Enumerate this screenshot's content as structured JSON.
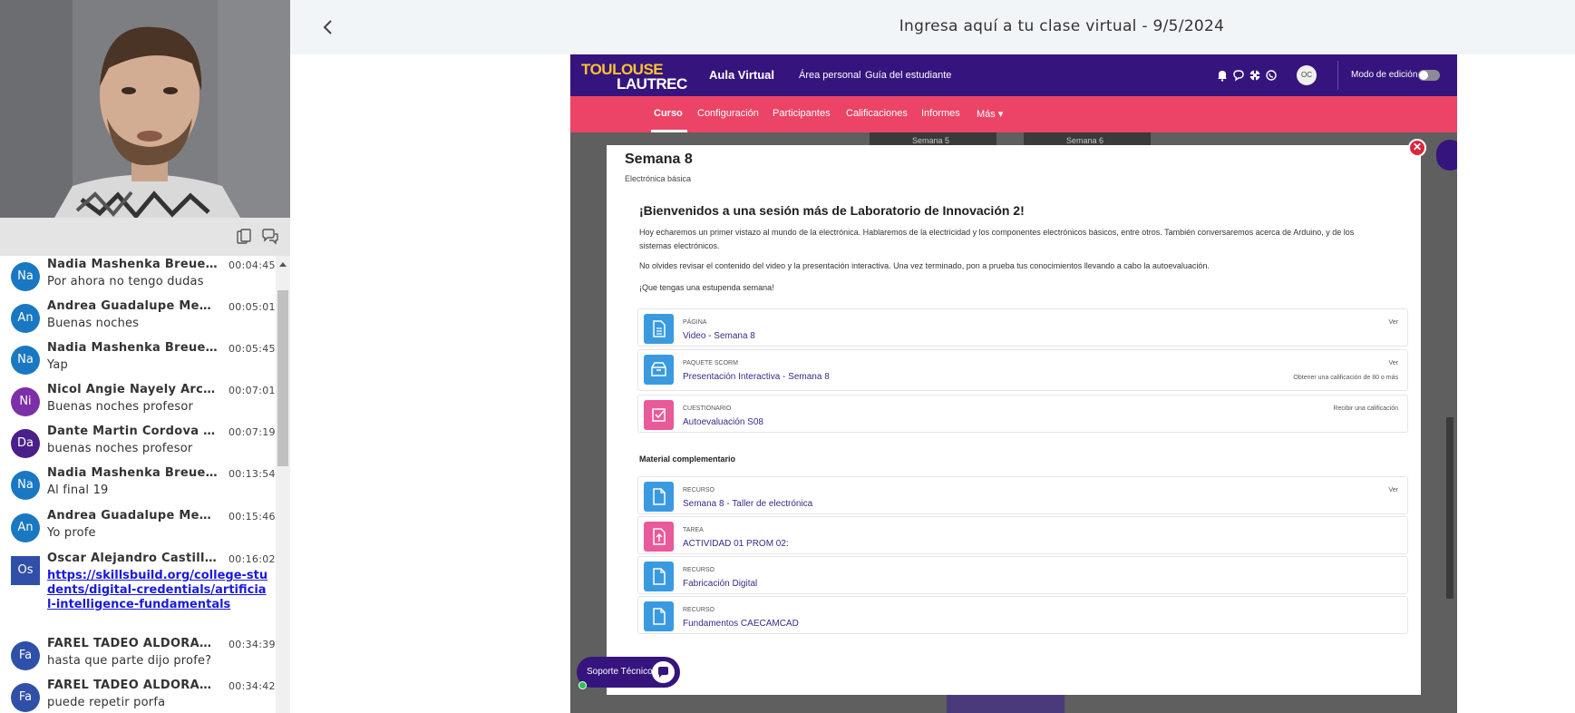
{
  "header": {
    "title": "Ingresa aquí a tu clase virtual - 9/5/2024",
    "back_icon": "chevron-left-icon"
  },
  "chat": {
    "messages": [
      {
        "initials": "Na",
        "color": "#1a78c2",
        "name": "Nadia Mashenka Breuer ...",
        "time": "00:04:45",
        "text": "Por ahora no tengo dudas"
      },
      {
        "initials": "An",
        "color": "#1a78c2",
        "name": "Andrea Guadalupe Mena...",
        "time": "00:05:01",
        "text": "Buenas noches"
      },
      {
        "initials": "Na",
        "color": "#1a78c2",
        "name": "Nadia Mashenka Breuer ...",
        "time": "00:05:45",
        "text": "Yap"
      },
      {
        "initials": "Ni",
        "color": "#7b2fa8",
        "name": "Nicol Angie Nayely Arca...",
        "time": "00:07:01",
        "text": "Buenas noches profesor"
      },
      {
        "initials": "Da",
        "color": "#4a1f8a",
        "name": "Dante Martin Cordova M...",
        "time": "00:07:19",
        "text": "buenas noches profesor"
      },
      {
        "initials": "Na",
        "color": "#1a78c2",
        "name": "Nadia Mashenka Breuer ...",
        "time": "00:13:54",
        "text": "Al final  19"
      },
      {
        "initials": "An",
        "color": "#1a78c2",
        "name": "Andrea Guadalupe Mena...",
        "time": "00:15:46",
        "text": "Yo profe"
      },
      {
        "initials": "Os",
        "color": "#2f4fa8",
        "name": "Oscar Alejandro Castillo...",
        "time": "00:16:02",
        "link": "https://skillsbuild.org/college-students/digital-credentials/artificial-intelligence-fundamentals"
      },
      {
        "initials": "Fa",
        "color": "#2f4fa8",
        "name": "FAREL TADEO ALDORAD...",
        "time": "00:34:39",
        "text": "hasta que parte dijo profe?"
      },
      {
        "initials": "Fa",
        "color": "#2f4fa8",
        "name": "FAREL TADEO ALDORAD...",
        "time": "00:34:42",
        "text": "puede repetir porfa"
      }
    ]
  },
  "moodle": {
    "logo_line1": "TOULOUSE",
    "logo_line2": "LAUTREC",
    "aula": "Aula Virtual",
    "nav_links": [
      "Área personal",
      "Guía del estudiante"
    ],
    "user_initials": "OC",
    "edit_mode": "Modo de edición",
    "tabs": [
      "Curso",
      "Configuración",
      "Participantes",
      "Calificaciones",
      "Informes",
      "Más"
    ],
    "bg_week_labels": [
      "Semana 5",
      "Semana 6"
    ],
    "modal": {
      "title": "Semana 8",
      "subtitle": "Electrónica básica",
      "welcome": "¡Bienvenidos a una sesión más de Laboratorio de Innovación 2!",
      "para1": "Hoy echaremos un primer vistazo al mundo de la electrónica. Hablaremos de la electricidad y los componentes electrónicos básicos, entre otros. También conversaremos acerca de Arduino, y de los sistemas electrónicos.",
      "para2": "No olvides revisar el contenido del video y la presentación interactiva. Una vez terminado, pon a prueba tus conocimientos llevando a cabo la autoevaluación.",
      "para3": "¡Que tengas una estupenda semana!",
      "activities": [
        {
          "type": "PÁGINA",
          "name": "Video - Semana 8",
          "right": "Ver",
          "note": "",
          "color": "#3a9ae0",
          "icon": "page-icon"
        },
        {
          "type": "PAQUETE SCORM",
          "name": "Presentación Interactiva - Semana 8",
          "right": "Ver",
          "note": "Obtener una calificación de 80 o más",
          "color": "#3a9ae0",
          "icon": "package-icon"
        },
        {
          "type": "CUESTIONARIO",
          "name": "Autoevaluación S08",
          "right": "Recibir una calificación",
          "note": "",
          "color": "#e85a9a",
          "icon": "quiz-icon"
        }
      ],
      "material_heading": "Material complementario",
      "material": [
        {
          "type": "RECURSO",
          "name": "Semana 8 - Taller de electrónica",
          "right": "Ver",
          "color": "#3a9ae0",
          "icon": "file-icon"
        },
        {
          "type": "TAREA",
          "name": "ACTIVIDAD 01 PROM 02:",
          "right": "",
          "color": "#e85a9a",
          "icon": "assignment-icon"
        },
        {
          "type": "RECURSO",
          "name": "Fabricación Digital",
          "right": "",
          "color": "#3a9ae0",
          "icon": "file-icon"
        },
        {
          "type": "RECURSO",
          "name": "Fundamentos CAECAMCAD",
          "right": "",
          "color": "#3a9ae0",
          "icon": "file-icon"
        }
      ]
    },
    "support": "Soporte Técnico"
  }
}
